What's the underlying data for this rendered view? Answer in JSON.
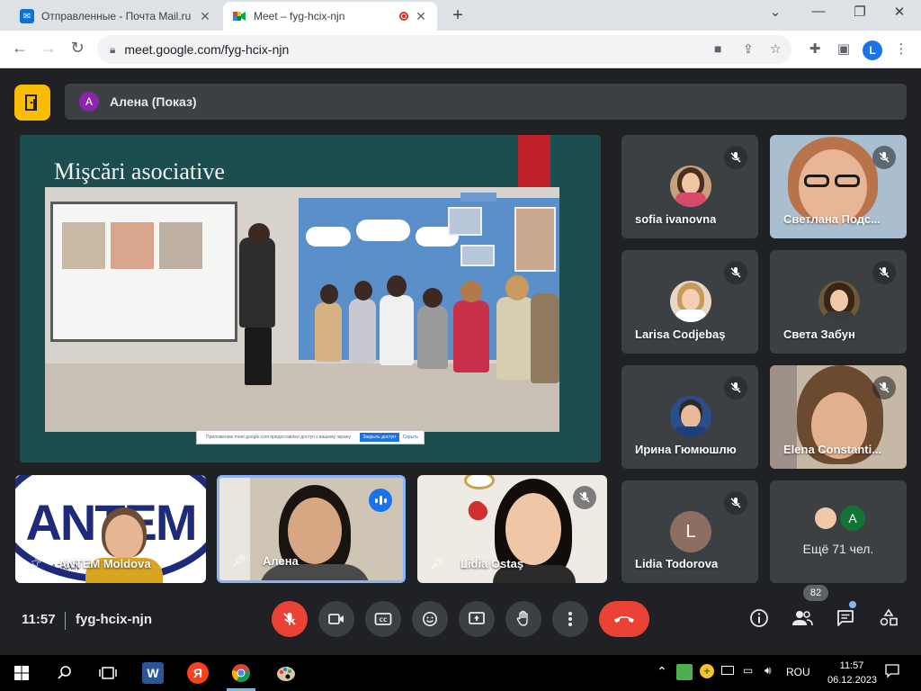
{
  "browser": {
    "tabs": [
      {
        "title": "Отправленные - Почта Mail.ru",
        "favicon": "mail-icon",
        "active": false
      },
      {
        "title": "Meet – fyg-hcix-njn",
        "favicon": "meet-icon",
        "active": true
      }
    ],
    "new_tab": "+",
    "window_controls": [
      "minimize",
      "restore",
      "close"
    ],
    "url": "meet.google.com/fyg-hcix-njn",
    "profile_initial": "L"
  },
  "meet": {
    "presenter_initial": "A",
    "presenter_label": "Алена (Показ)",
    "slide_title": "Mişcări asociative",
    "share_notice": {
      "text": "Приложению meet.google.com предоставлен доступ к вашему экрану",
      "stop_button": "Закрыть доступ",
      "hide_button": "Скрыть"
    },
    "participants": [
      {
        "name": "sofia ivanovna",
        "type": "photo-avatar",
        "muted": true
      },
      {
        "name": "Светлана Подс...",
        "type": "video",
        "muted": true
      },
      {
        "name": "Larisa Codjebaş",
        "type": "photo-avatar",
        "muted": true
      },
      {
        "name": "Света Забун",
        "type": "photo-avatar",
        "muted": true
      },
      {
        "name": "Ирина Гюмюшлю",
        "type": "photo-avatar",
        "muted": true
      },
      {
        "name": "Elena Constanti...",
        "type": "video",
        "muted": true
      },
      {
        "name": "Lidia Todorova",
        "type": "letter-avatar",
        "initial": "L",
        "muted": true
      }
    ],
    "bottom_tiles": [
      {
        "name": "ANTEM Moldova",
        "logo_text": "ANTEM",
        "logo_sub": "A TRAIN"
      },
      {
        "name": "Алена",
        "speaking": true
      },
      {
        "name": "Lidia Ostaş",
        "muted": true
      }
    ],
    "more": {
      "label": "Ещё 71 чел.",
      "initial": "A"
    },
    "time": "11:57",
    "meeting_code": "fyg-hcix-njn",
    "people_count": "82"
  },
  "taskbar": {
    "language": "ROU",
    "clock_time": "11:57",
    "clock_date": "06.12.2023",
    "apps": [
      "start-icon",
      "search-icon",
      "task-view-icon",
      "word-icon",
      "yandex-icon",
      "chrome-icon",
      "paint-icon"
    ],
    "yandex_letter": "Я",
    "word_letter": "W"
  }
}
